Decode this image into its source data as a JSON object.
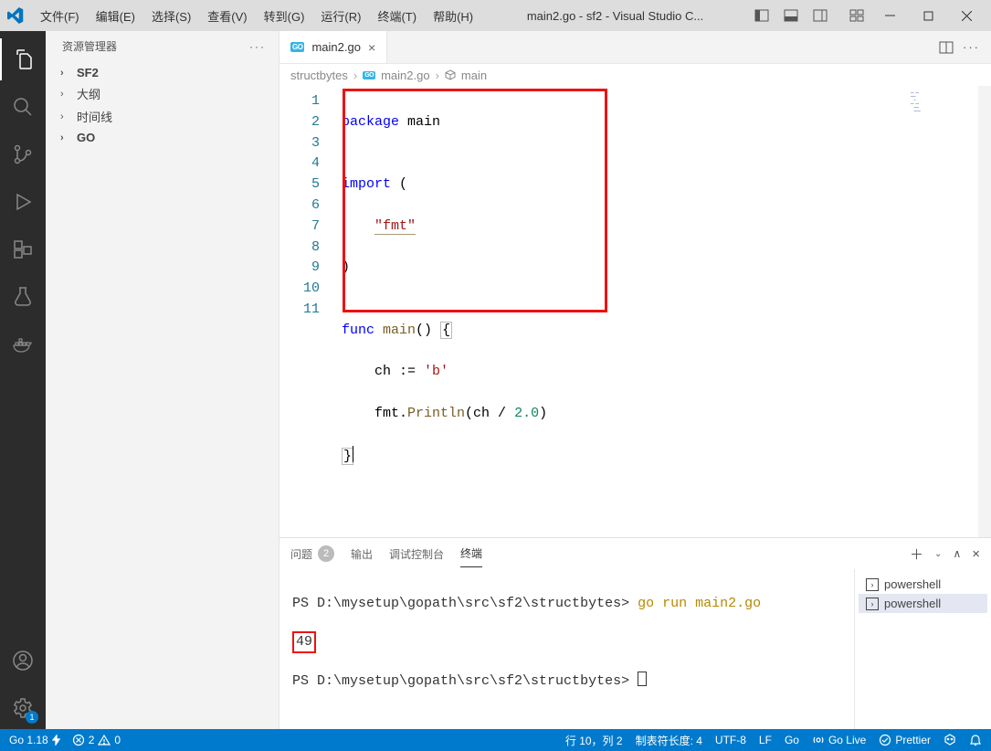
{
  "titlebar": {
    "menus": [
      "文件(F)",
      "编辑(E)",
      "选择(S)",
      "查看(V)",
      "转到(G)",
      "运行(R)",
      "终端(T)",
      "帮助(H)"
    ],
    "title": "main2.go - sf2 - Visual Studio C..."
  },
  "sidebar": {
    "title": "资源管理器",
    "items": [
      {
        "label": "SF2",
        "bold": true
      },
      {
        "label": "大纲",
        "bold": false
      },
      {
        "label": "时间线",
        "bold": false
      },
      {
        "label": "GO",
        "bold": true
      }
    ]
  },
  "tab": {
    "icon": "GO",
    "label": "main2.go"
  },
  "breadcrumbs": {
    "a": "structbytes",
    "b_icon": "GO",
    "b": "main2.go",
    "c": "main"
  },
  "code": {
    "lines": {
      "1": {
        "a": "package",
        "b": " main"
      },
      "2": "",
      "3": {
        "a": "import",
        "b": " ("
      },
      "4": {
        "pad": "    ",
        "a": "\"fmt\""
      },
      "5": ")",
      "6": "",
      "7": {
        "a": "func",
        "b": " ",
        "c": "main",
        "d": "() ",
        "e": "{"
      },
      "8": {
        "pad": "    ",
        "a": "ch := ",
        "b": "'b'"
      },
      "9": {
        "pad": "    ",
        "a": "fmt.",
        "b": "Println",
        "c": "(ch / ",
        "d": "2.0",
        "e": ")"
      },
      "10": "}",
      "11": ""
    },
    "gutter_lines": [
      "1",
      "2",
      "3",
      "4",
      "5",
      "6",
      "7",
      "8",
      "9",
      "10",
      "11"
    ]
  },
  "panel": {
    "tabs": {
      "problems": "问题",
      "problems_count": "2",
      "output": "输出",
      "debug": "调试控制台",
      "terminal": "终端"
    },
    "terminal": {
      "line1a": "PS ",
      "line1b": "D:\\mysetup\\gopath\\src\\sf2\\structbytes> ",
      "line1c": "go run main2.go",
      "line2": "49",
      "line3a": "PS ",
      "line3b": "D:\\mysetup\\gopath\\src\\sf2\\structbytes> "
    },
    "term_side": [
      "powershell",
      "powershell"
    ]
  },
  "status": {
    "go": "Go 1.18",
    "err": "2",
    "warn": "0",
    "ln": "行 10，列 2",
    "tab": "制表符长度: 4",
    "enc": "UTF-8",
    "eol": "LF",
    "lang": "Go",
    "golive": "Go Live",
    "prettier": "Prettier"
  },
  "settings_badge": "1"
}
